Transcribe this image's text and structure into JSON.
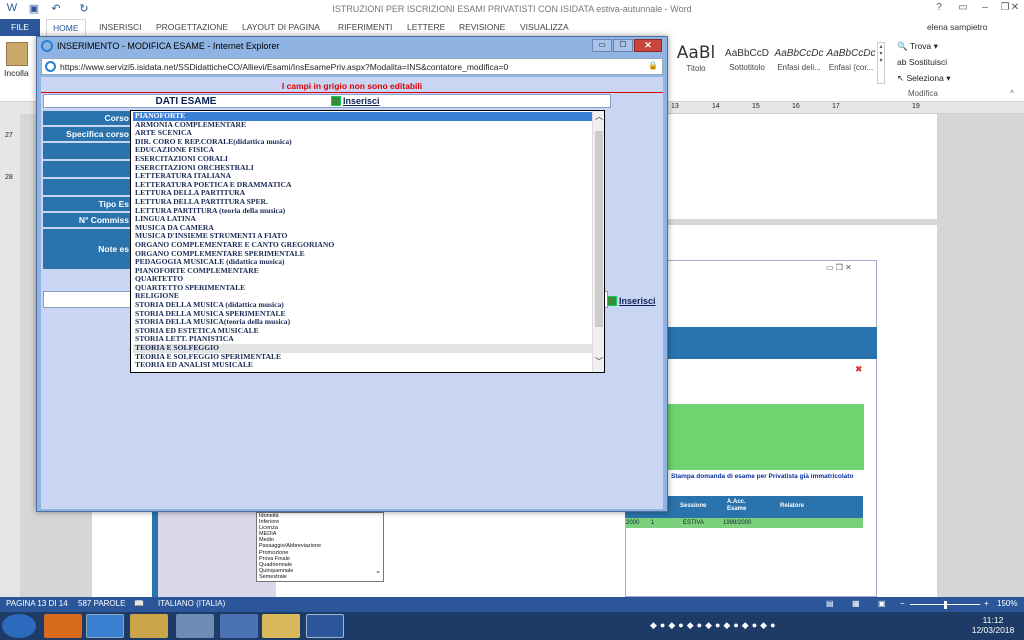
{
  "word": {
    "title": "ISTRUZIONI PER ISCRIZIONI ESAMI PRIVATISTI CON ISIDATA estiva-autunnale - Word",
    "user": "elena sampietro",
    "tabs": [
      "FILE",
      "HOME",
      "INSERISCI",
      "PROGETTAZIONE",
      "LAYOUT DI PAGINA",
      "RIFERIMENTI",
      "LETTERE",
      "REVISIONE",
      "VISUALIZZA"
    ],
    "paste_label": "Incolla",
    "styles": [
      {
        "sample": "AaBl",
        "name": "Titolo"
      },
      {
        "sample": "AaBbCcD",
        "name": "Sottotitolo"
      },
      {
        "sample": "AaBbCcDc",
        "name": "Enfasi deli..."
      },
      {
        "sample": "AaBbCcDc",
        "name": "Enfasi (cor..."
      }
    ],
    "find": "Trova",
    "replace": "Sostituisci",
    "select": "Seleziona",
    "group_edit": "Modifica",
    "ruler": [
      "13",
      "14",
      "15",
      "16",
      "17",
      "19"
    ],
    "left_ruler": [
      "27",
      "28"
    ],
    "status": {
      "page": "PAGINA 13 DI 14",
      "words": "587 PAROLE",
      "lang": "ITALIANO (ITALIA)",
      "zoom": "150%"
    },
    "clock": {
      "time": "11:12",
      "date": "12/03/2018"
    }
  },
  "ie": {
    "title": "INSERIMENTO - MODIFICA ESAME - Internet Explorer",
    "url": "https://www.servizi5.isidata.net/SSDidatticheCO/Allievi/Esami/InsEsamePriv.aspx?Modalita=INS&contatore_modifica=0",
    "note": "I campi in grigio non sono editabili",
    "header": "DATI ESAME",
    "insert_label": "Inserisci",
    "labels": [
      "Corso",
      "Specifica corso",
      "",
      "",
      "",
      "Tipo Es",
      "N° Commiss",
      "Note es"
    ]
  },
  "dropdown": {
    "selected": "PIANOFORTE",
    "hovered": "TEORIA E SOLFEGGIO",
    "items": [
      "PIANOFORTE",
      "ARMONIA COMPLEMENTARE",
      "ARTE SCENICA",
      "DIR. CORO E REP.CORALE(didattica musica)",
      "EDUCAZIONE FISICA",
      "ESERCITAZIONI CORALI",
      "ESERCITAZIONI ORCHESTRALI",
      "LETTERATURA ITALIANA",
      "LETTERATURA POETICA E DRAMMATICA",
      "LETTURA DELLA PARTITURA",
      "LETTURA DELLA PARTITURA SPER.",
      "LETTURA PARTITURA (teoria della musica)",
      "LINGUA LATINA",
      "MUSICA DA CAMERA",
      "MUSICA D'INSIEME STRUMENTI A FIATO",
      "ORGANO COMPLEMENTARE E CANTO GREGORIANO",
      "ORGANO COMPLEMENTARE SPERIMENTALE",
      "PEDAGOGIA MUSICALE (didattica musica)",
      "PIANOFORTE COMPLEMENTARE",
      "QUARTETTO",
      "QUARTETTO SPERIMENTALE",
      "RELIGIONE",
      "STORIA DELLA MUSICA (didattica musica)",
      "STORIA DELLA MUSICA SPERIMENTALE",
      "STORIA DELLA MUSICA(teoria della musica)",
      "STORIA ED ESTETICA MUSICALE",
      "STORIA LETT. PIANISTICA",
      "TEORIA E SOLFEGGIO",
      "TEORIA E SOLFEGGIO SPERIMENTALE",
      "TEORIA ED ANALISI MUSICALE"
    ]
  },
  "embedded": {
    "print_link": "Stampa domanda di esame per Privatista già immatricolato",
    "headers": [
      "Sessione",
      "A.Acc. Esame",
      "Relatore"
    ],
    "row": [
      "2000",
      "1",
      "ESTIVA",
      "1999/2000"
    ],
    "list": [
      "Idoneità",
      "Inferiore",
      "Licenza",
      "MEDIA",
      "Medio",
      "Passaggio/Abbreviazione",
      "Promozione",
      "Prova Finale",
      "Quadriennale",
      "Quinquennale",
      "Semestrale"
    ]
  }
}
